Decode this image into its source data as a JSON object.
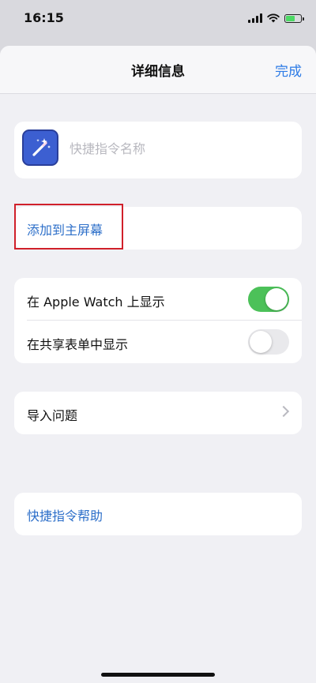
{
  "status_bar": {
    "time": "16:15"
  },
  "nav": {
    "title": "详细信息",
    "done_label": "完成"
  },
  "shortcut": {
    "name_value": "",
    "name_placeholder": "快捷指令名称",
    "icon": "magic-wand-icon"
  },
  "add_to_home": {
    "label": "添加到主屏幕"
  },
  "settings": {
    "show_on_watch": {
      "label": "在 Apple Watch 上显示",
      "on": true
    },
    "show_in_share_sheet": {
      "label": "在共享表单中显示",
      "on": false
    }
  },
  "import_questions": {
    "label": "导入问题"
  },
  "help": {
    "label": "快捷指令帮助"
  },
  "colors": {
    "accent": "#2d6fc9",
    "toggle_on": "#4cc159",
    "highlight": "#d0202a"
  }
}
